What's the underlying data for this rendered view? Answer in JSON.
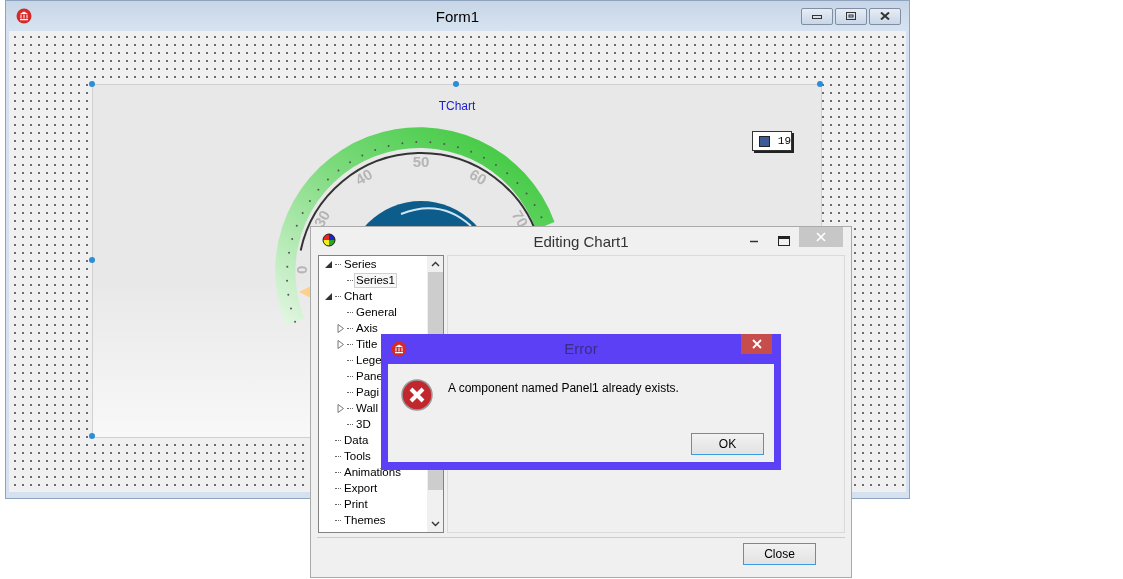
{
  "form_window": {
    "title": "Form1"
  },
  "chart": {
    "title": "TChart",
    "legend": {
      "value": "19",
      "color": "#3d5a98"
    },
    "gauge": {
      "labels": [
        "0",
        "30",
        "40",
        "50",
        "60",
        "70"
      ]
    }
  },
  "editor_window": {
    "title": "Editing Chart1",
    "tree": [
      {
        "label": "Series",
        "expanded": true,
        "selected": false,
        "children": [
          {
            "label": "Series1",
            "selected": true
          }
        ]
      },
      {
        "label": "Chart",
        "expanded": true,
        "selected": false,
        "children": [
          {
            "label": "General",
            "selected": false
          },
          {
            "label": "Axis",
            "expanded": false,
            "selected": false
          },
          {
            "label": "Title",
            "expanded": false,
            "selected": false
          },
          {
            "label": "Lege",
            "selected": false
          },
          {
            "label": "Pane",
            "selected": false
          },
          {
            "label": "Pagi",
            "selected": false
          },
          {
            "label": "Wall",
            "expanded": false,
            "selected": false
          },
          {
            "label": "3D",
            "selected": false
          }
        ]
      },
      {
        "label": "Data",
        "selected": false
      },
      {
        "label": "Tools",
        "selected": false
      },
      {
        "label": "Animations",
        "selected": false
      },
      {
        "label": "Export",
        "selected": false
      },
      {
        "label": "Print",
        "selected": false
      },
      {
        "label": "Themes",
        "selected": false
      }
    ],
    "buttons": [
      "Close"
    ]
  },
  "error_dialog": {
    "title": "Error",
    "message": "A component named Panel1 already exists.",
    "buttons": [
      "OK"
    ]
  }
}
